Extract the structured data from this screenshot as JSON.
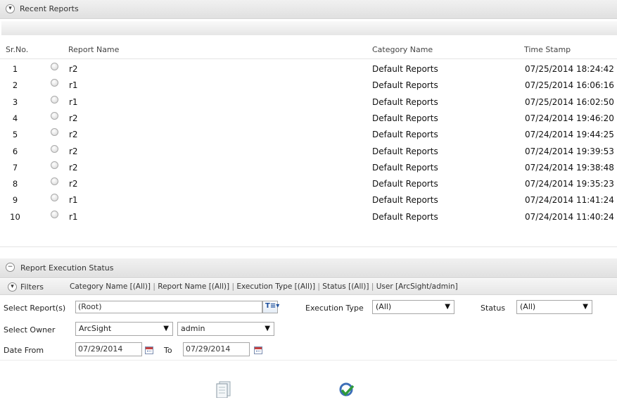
{
  "recent_reports": {
    "title": "Recent Reports",
    "columns": {
      "srno": "Sr.No.",
      "name": "Report Name",
      "category": "Category Name",
      "timestamp": "Time Stamp"
    },
    "rows": [
      {
        "n": "1",
        "name": "r2",
        "category": "Default Reports",
        "ts": "07/25/2014 18:24:42"
      },
      {
        "n": "2",
        "name": "r1",
        "category": "Default Reports",
        "ts": "07/25/2014 16:06:16"
      },
      {
        "n": "3",
        "name": "r1",
        "category": "Default Reports",
        "ts": "07/25/2014 16:02:50"
      },
      {
        "n": "4",
        "name": "r2",
        "category": "Default Reports",
        "ts": "07/24/2014 19:46:20"
      },
      {
        "n": "5",
        "name": "r2",
        "category": "Default Reports",
        "ts": "07/24/2014 19:44:25"
      },
      {
        "n": "6",
        "name": "r2",
        "category": "Default Reports",
        "ts": "07/24/2014 19:39:53"
      },
      {
        "n": "7",
        "name": "r2",
        "category": "Default Reports",
        "ts": "07/24/2014 19:38:48"
      },
      {
        "n": "8",
        "name": "r2",
        "category": "Default Reports",
        "ts": "07/24/2014 19:35:23"
      },
      {
        "n": "9",
        "name": "r1",
        "category": "Default Reports",
        "ts": "07/24/2014 11:41:24"
      },
      {
        "n": "10",
        "name": "r1",
        "category": "Default Reports",
        "ts": "07/24/2014 11:40:24"
      }
    ]
  },
  "execution_status": {
    "title": "Report Execution Status",
    "filters": {
      "title": "Filters",
      "summary": [
        "Category Name [(All)]",
        "Report Name [(All)]",
        "Execution Type [(All)]",
        "Status [(All)]",
        "User [ArcSight/admin]"
      ]
    },
    "form": {
      "select_reports_label": "Select Report(s)",
      "select_reports_value": "(Root)",
      "execution_type_label": "Execution Type",
      "execution_type_value": "(All)",
      "status_label": "Status",
      "status_value": "(All)",
      "select_owner_label": "Select Owner",
      "owner_group_value": "ArcSight",
      "owner_user_value": "admin",
      "date_from_label": "Date From",
      "date_from_value": "07/29/2014",
      "to_label": "To",
      "date_to_value": "07/29/2014"
    }
  }
}
